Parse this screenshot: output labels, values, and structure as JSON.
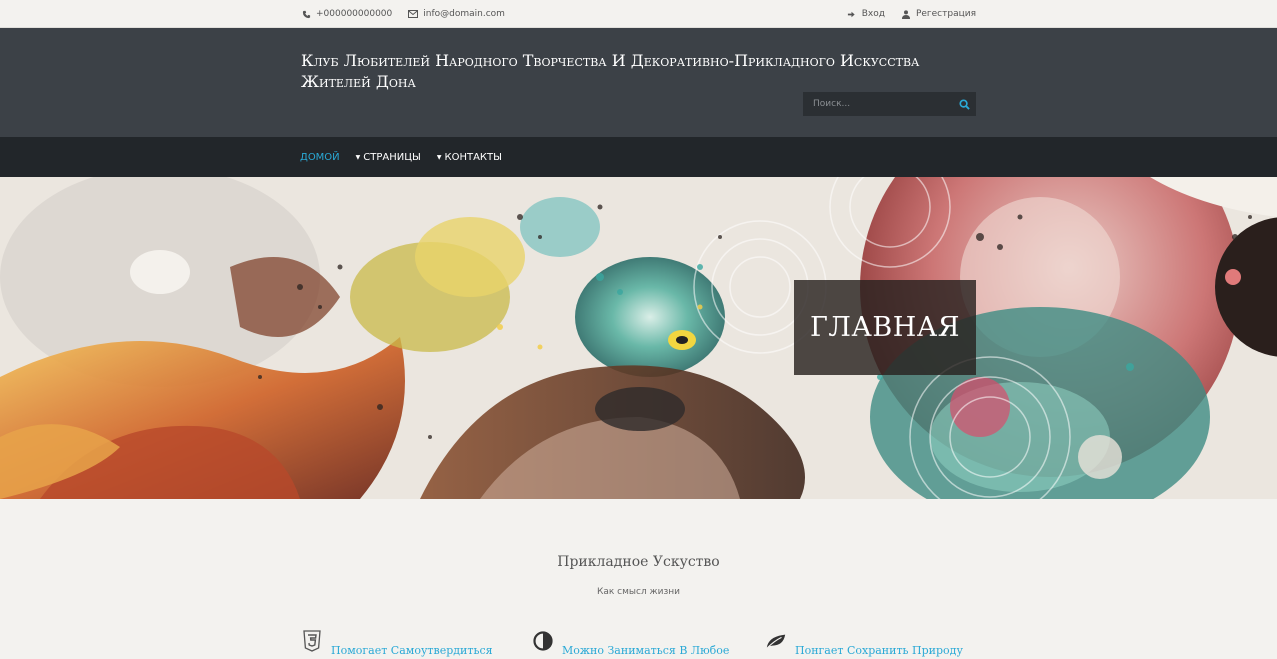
{
  "topbar": {
    "phone": "+000000000000",
    "email": "info@domain.com",
    "login": "Вход",
    "register": "Регестрация",
    "icons": [
      "phone-icon",
      "envelope-icon",
      "sign-in-icon",
      "user-icon"
    ]
  },
  "header": {
    "site_title": "Клуб Любителей Народного Творчества И Декоративно-Прикладного Искусства Жителей Дона",
    "search_placeholder": "Поиск..."
  },
  "nav": {
    "items": [
      {
        "label": "ДОМОЙ",
        "active": true
      },
      {
        "label": "СТРАНИЦЫ",
        "dropdown": true
      },
      {
        "label": "КОНТАКТЫ",
        "dropdown": true
      }
    ]
  },
  "hero": {
    "title": "ГЛАВНАЯ"
  },
  "section": {
    "title": "Прикладное Ускуство",
    "subtitle": "Как смысл жизни"
  },
  "features": [
    {
      "label": "Помогает Самоутвердиться",
      "icon": "html5-icon"
    },
    {
      "label": "Можно Заниматься В Любое",
      "icon": "adjust-icon"
    },
    {
      "label": "Понгает Сохранить Природу",
      "icon": "leaf-icon"
    }
  ],
  "colors": {
    "accent": "#2aa9d6",
    "header_bg": "#3c4147",
    "nav_bg": "#22262a",
    "page_bg": "#f3f2ef"
  }
}
